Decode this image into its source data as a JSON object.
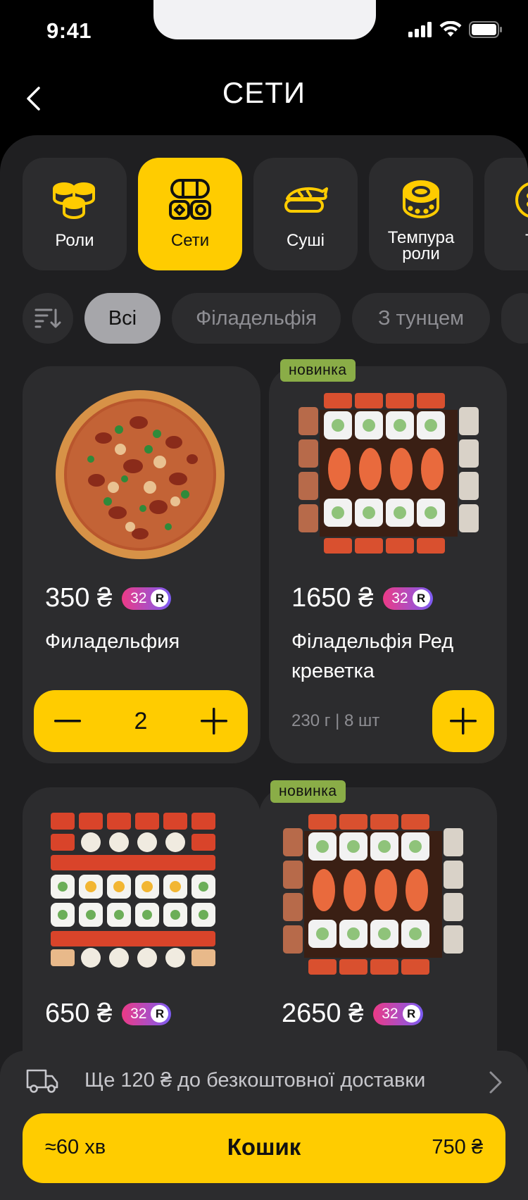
{
  "status_bar": {
    "time": "9:41"
  },
  "header": {
    "title": "СЕТИ"
  },
  "categories": [
    {
      "label": "Роли",
      "icon": "rolls-icon",
      "active": false
    },
    {
      "label": "Сети",
      "icon": "sets-icon",
      "active": true
    },
    {
      "label": "Суші",
      "icon": "sushi-icon",
      "active": false
    },
    {
      "label": "Темпура роли",
      "icon": "tempura-roll-icon",
      "active": false
    },
    {
      "label": "Т",
      "icon": "roll-icon",
      "active": false
    }
  ],
  "filters": {
    "sort_icon": "sort-icon",
    "chips": [
      {
        "label": "Всі",
        "active": true
      },
      {
        "label": "Філадельфія",
        "active": false
      },
      {
        "label": "З тунцем",
        "active": false
      }
    ]
  },
  "products": [
    {
      "price": "350 ₴",
      "bonus": "32",
      "bonus_symbol": "R",
      "name": "Филадельфия",
      "quantity": "2",
      "badge": "",
      "weight": "",
      "image": "pizza"
    },
    {
      "price": "1650 ₴",
      "bonus": "32",
      "bonus_symbol": "R",
      "name": "Філадельфія Ред креветка",
      "quantity": "",
      "badge": "новинка",
      "weight": "230 г | 8 шт",
      "image": "sushi-set-shrimp"
    },
    {
      "price": "650 ₴",
      "bonus": "32",
      "bonus_symbol": "R",
      "name": "",
      "quantity": "",
      "badge": "",
      "weight": "",
      "image": "sushi-set-grid"
    },
    {
      "price": "2650 ₴",
      "bonus": "32",
      "bonus_symbol": "R",
      "name": "",
      "quantity": "",
      "badge": "новинка",
      "weight": "",
      "image": "sushi-set-shrimp"
    }
  ],
  "delivery": {
    "text": "Ще 120 ₴ до безкоштовної доставки",
    "icon": "truck-icon"
  },
  "cart": {
    "eta": "≈60 хв",
    "label": "Кошик",
    "total": "750 ₴"
  },
  "colors": {
    "accent": "#ffcc00",
    "surface": "#2c2c2e",
    "sheet": "#1f1f21",
    "badge_new": "#8aad47"
  }
}
